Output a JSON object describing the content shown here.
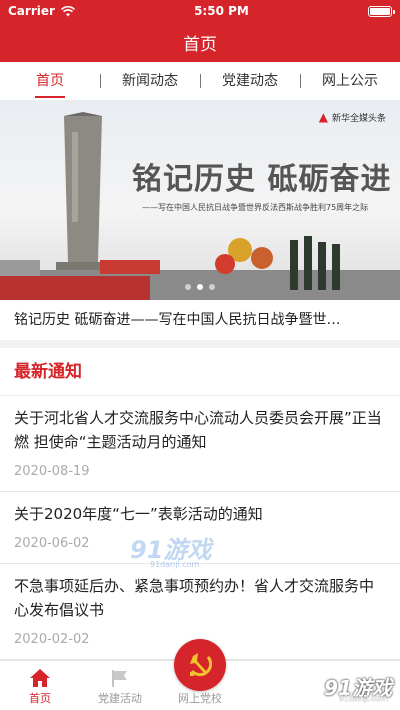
{
  "status_bar": {
    "carrier": "Carrier",
    "time": "5:50 PM"
  },
  "nav": {
    "title": "首页"
  },
  "tabs": [
    {
      "label": "首页",
      "active": true
    },
    {
      "label": "新闻动态",
      "active": false
    },
    {
      "label": "党建动态",
      "active": false
    },
    {
      "label": "网上公示",
      "active": false
    }
  ],
  "banner": {
    "logo_text": "新华全媒头条",
    "headline": "铭记历史 砥砺奋进",
    "subtitle": "——写在中国人民抗日战争暨世界反法西斯战争胜利75周年之际",
    "caption": "铭记历史 砥砺奋进——写在中国人民抗日战争暨世…",
    "slide_count": 3,
    "active_slide": 2
  },
  "notices": {
    "heading": "最新通知",
    "items": [
      {
        "title": "关于河北省人才交流服务中心流动人员委员会开展”正当燃 担使命“主题活动月的通知",
        "date": "2020-08-19"
      },
      {
        "title": "关于2020年度“七一”表彰活动的通知",
        "date": "2020-06-02"
      },
      {
        "title": "不急事项延后办、紧急事项预约办！省人才交流服务中心发布倡议书",
        "date": "2020-02-02"
      }
    ]
  },
  "bottom_bar": {
    "items": [
      {
        "label": "首页",
        "icon": "home-icon",
        "active": true
      },
      {
        "label": "党建活动",
        "icon": "flag-icon",
        "active": false
      },
      {
        "label": "网上党校",
        "icon": "party-emblem-icon",
        "active": false
      }
    ]
  },
  "watermark": {
    "text": "91游戏",
    "sub": "91danji.com"
  },
  "colors": {
    "primary": "#d6242b"
  }
}
